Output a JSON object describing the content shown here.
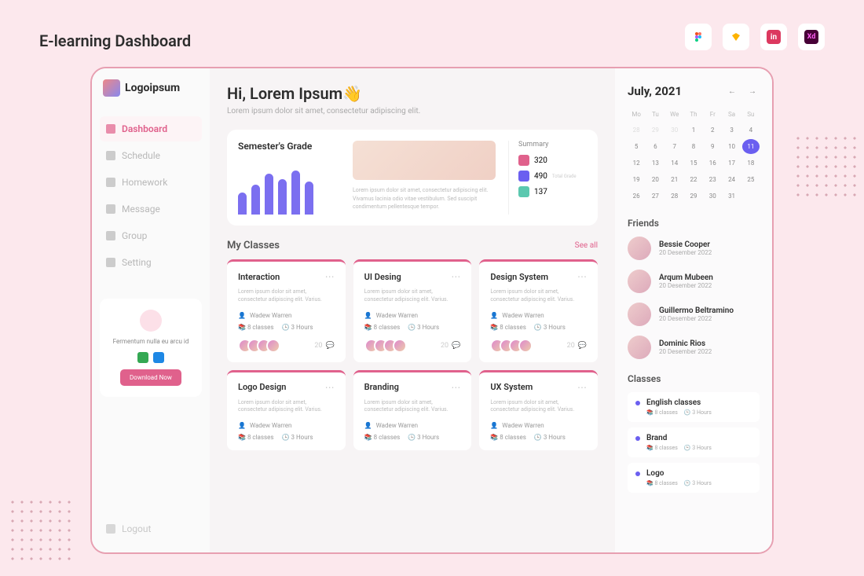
{
  "outer_title": "E-learning Dashboard",
  "tools": [
    "figma",
    "sketch",
    "invision",
    "xd"
  ],
  "logo": "Logoipsum",
  "nav": [
    {
      "label": "Dashboard",
      "active": true
    },
    {
      "label": "Schedule",
      "active": false
    },
    {
      "label": "Homework",
      "active": false
    },
    {
      "label": "Message",
      "active": false
    },
    {
      "label": "Group",
      "active": false
    },
    {
      "label": "Setting",
      "active": false
    }
  ],
  "promo": {
    "text": "Fermentum nulla eu arcu id",
    "button": "Download Now"
  },
  "logout": "Logout",
  "greeting": {
    "title": "Hi, Lorem Ipsum👋",
    "sub": "Lorem ipsum dolor sit amet, consectetur adipiscing elit."
  },
  "hero": {
    "title": "Semester's Grade",
    "bars": [
      40,
      55,
      75,
      65,
      80,
      60
    ],
    "desc": "Lorem ipsum dolor sit amet, consectetur adipiscing elit. Vivamus lacinia odio vitae vestibulum. Sed suscipit condimentum pellentesque tempor.",
    "summary_title": "Summary",
    "summary": [
      {
        "color": "#e0618c",
        "value": "320",
        "label": ""
      },
      {
        "color": "#6b5ff0",
        "value": "490",
        "label": "Total Grade"
      },
      {
        "color": "#5bc8af",
        "value": "137",
        "label": ""
      }
    ]
  },
  "classes_title": "My Classes",
  "see_all": "See all",
  "classes": [
    {
      "title": "Interaction",
      "desc": "Lorem ipsum dolor sit amet, consectetur adipiscing elit. Varius.",
      "teacher": "Wadew Warren",
      "count": "8 classes",
      "hours": "3 Hours",
      "comments": "20"
    },
    {
      "title": "UI Desing",
      "desc": "Lorem ipsum dolor sit amet, consectetur adipiscing elit. Varius.",
      "teacher": "Wadew Warren",
      "count": "8 classes",
      "hours": "3 Hours",
      "comments": "20"
    },
    {
      "title": "Design System",
      "desc": "Lorem ipsum dolor sit amet, consectetur adipiscing elit. Varius.",
      "teacher": "Wadew Warren",
      "count": "8 classes",
      "hours": "3 Hours",
      "comments": "20"
    },
    {
      "title": "Logo Design",
      "desc": "Lorem ipsum dolor sit amet, consectetur adipiscing elit. Varius.",
      "teacher": "Wadew Warren",
      "count": "8 classes",
      "hours": "3 Hours",
      "comments": "20"
    },
    {
      "title": "Branding",
      "desc": "Lorem ipsum dolor sit amet, consectetur adipiscing elit. Varius.",
      "teacher": "Wadew Warren",
      "count": "8 classes",
      "hours": "3 Hours",
      "comments": "20"
    },
    {
      "title": "UX System",
      "desc": "Lorem ipsum dolor sit amet, consectetur adipiscing elit. Varius.",
      "teacher": "Wadew Warren",
      "count": "8 classes",
      "hours": "3 Hours",
      "comments": "20"
    }
  ],
  "calendar": {
    "title": "July, 2021",
    "dow": [
      "Mo",
      "Tu",
      "We",
      "Th",
      "Fr",
      "Sa",
      "Su"
    ],
    "days": [
      {
        "n": "28",
        "m": true
      },
      {
        "n": "29",
        "m": true
      },
      {
        "n": "30",
        "m": true
      },
      {
        "n": "1"
      },
      {
        "n": "2"
      },
      {
        "n": "3"
      },
      {
        "n": "4"
      },
      {
        "n": "5"
      },
      {
        "n": "6"
      },
      {
        "n": "7"
      },
      {
        "n": "8"
      },
      {
        "n": "9"
      },
      {
        "n": "10"
      },
      {
        "n": "11",
        "a": true
      },
      {
        "n": "12"
      },
      {
        "n": "13"
      },
      {
        "n": "14"
      },
      {
        "n": "15"
      },
      {
        "n": "16"
      },
      {
        "n": "17"
      },
      {
        "n": "18"
      },
      {
        "n": "19"
      },
      {
        "n": "20"
      },
      {
        "n": "21"
      },
      {
        "n": "22"
      },
      {
        "n": "23"
      },
      {
        "n": "24"
      },
      {
        "n": "25"
      },
      {
        "n": "26"
      },
      {
        "n": "27"
      },
      {
        "n": "28"
      },
      {
        "n": "29"
      },
      {
        "n": "30"
      },
      {
        "n": "31"
      }
    ]
  },
  "friends_title": "Friends",
  "friends": [
    {
      "name": "Bessie Cooper",
      "date": "20 Desember 2022"
    },
    {
      "name": "Arqum Mubeen",
      "date": "20 Desember 2022"
    },
    {
      "name": "Guillermo Beltramino",
      "date": "20 Desember 2022"
    },
    {
      "name": "Dominic Rios",
      "date": "20 Desember 2022"
    }
  ],
  "classes_side_title": "Classes",
  "classes_side": [
    {
      "title": "English classes",
      "count": "8 classes",
      "hours": "3 Hours"
    },
    {
      "title": "Brand",
      "count": "8 classes",
      "hours": "3 Hours"
    },
    {
      "title": "Logo",
      "count": "8 classes",
      "hours": "3 Hours"
    }
  ]
}
